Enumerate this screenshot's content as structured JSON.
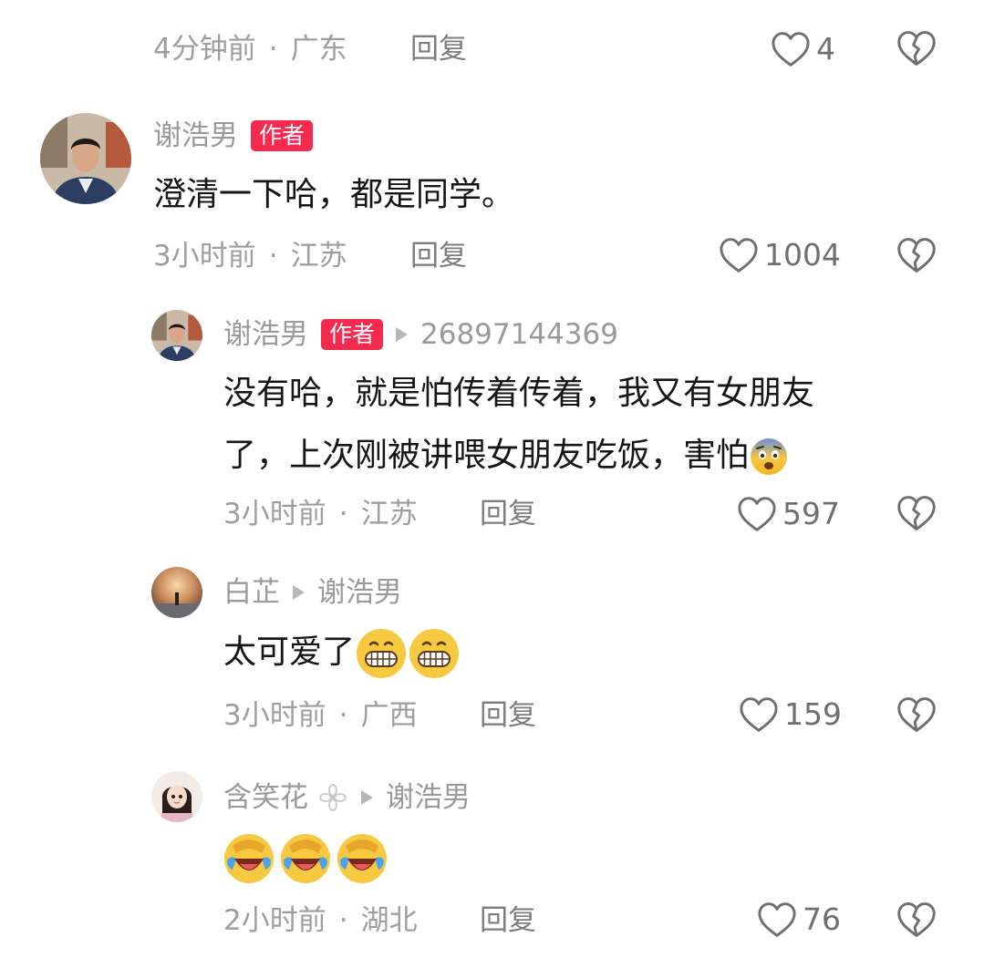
{
  "top_comment": {
    "time": "4分钟前",
    "location": "广东",
    "reply_label": "回复",
    "likes": "4"
  },
  "comments": [
    {
      "user": "谢浩男",
      "badge": "作者",
      "text": "澄清一下哈，都是同学。",
      "time": "3小时前",
      "location": "江苏",
      "reply_label": "回复",
      "likes": "1004"
    },
    {
      "user": "谢浩男",
      "badge": "作者",
      "reply_to": "26897144369",
      "text_line1": "没有哈，就是怕传着传着，我又有女朋友",
      "text_line2": "了，上次刚被讲喂女朋友吃饭，害怕",
      "emoji": "fearful-face-emoji",
      "time": "3小时前",
      "location": "江苏",
      "reply_label": "回复",
      "likes": "597"
    },
    {
      "user": "白芷",
      "reply_to": "谢浩男",
      "text": "太可爱了",
      "emoji": "grinning-face-emoji",
      "time": "3小时前",
      "location": "广西",
      "reply_label": "回复",
      "likes": "159"
    },
    {
      "user": "含笑花",
      "user_decor": "flower-icon",
      "reply_to": "谢浩男",
      "emoji": "rolling-laughing-emoji",
      "time": "2小时前",
      "location": "湖北",
      "reply_label": "回复",
      "likes": "76"
    }
  ],
  "separator": "·",
  "colors": {
    "badge": "#f42b4f",
    "meta_text": "#9e9e9e",
    "body_text": "#161616"
  }
}
